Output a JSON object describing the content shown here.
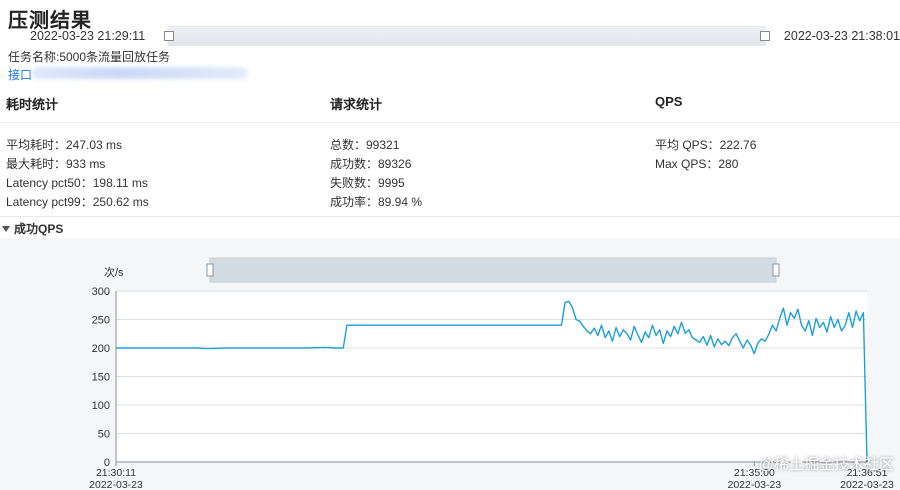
{
  "header": {
    "title": "压测结果",
    "start_time": "2022-03-23 21:29:11",
    "end_time": "2022-03-23 21:38:01",
    "task_label": "任务名称:5000条流量回放任务",
    "api_label": "接口"
  },
  "stats": {
    "latency": {
      "heading": "耗时统计",
      "lines": [
        "平均耗时：247.03 ms",
        "最大耗时：933 ms",
        "Latency pct50：198.11 ms",
        "Latency pct99：250.62 ms"
      ]
    },
    "requests": {
      "heading": "请求统计",
      "lines": [
        "总数：99321",
        "成功数：89326",
        "失败数：9995",
        "成功率：89.94 %"
      ]
    },
    "qps": {
      "heading": "QPS",
      "lines": [
        "平均 QPS：222.76",
        "Max QPS：280"
      ]
    }
  },
  "chart_section": {
    "label": "成功QPS"
  },
  "watermark": "@稀土掘金技术社区",
  "chart_data": {
    "type": "line",
    "ylabel": "次/s",
    "ylim": [
      0,
      300
    ],
    "yticks": [
      0,
      50,
      100,
      150,
      200,
      250,
      300
    ],
    "xrange": [
      0,
      340
    ],
    "xticks": [
      {
        "x": 0,
        "time": "21:30:11",
        "date": "2022-03-23"
      },
      {
        "x": 289,
        "time": "21:35:00",
        "date": "2022-03-23"
      },
      {
        "x": 340,
        "time": "21:36:51",
        "date": "2022-03-23"
      }
    ],
    "color": "#1aa0d8",
    "series": [
      {
        "points": [
          [
            0,
            200
          ],
          [
            15,
            200
          ],
          [
            30,
            200
          ],
          [
            45,
            200
          ],
          [
            50,
            199
          ],
          [
            60,
            200
          ],
          [
            75,
            200
          ],
          [
            90,
            200
          ],
          [
            105,
            200
          ],
          [
            115,
            201
          ],
          [
            120,
            200
          ],
          [
            125,
            200
          ],
          [
            127,
            240
          ],
          [
            140,
            240
          ],
          [
            155,
            240
          ],
          [
            170,
            240
          ],
          [
            185,
            240
          ],
          [
            200,
            240
          ],
          [
            215,
            240
          ],
          [
            230,
            240
          ],
          [
            245,
            240
          ],
          [
            247,
            280
          ],
          [
            249,
            282
          ],
          [
            251,
            271
          ],
          [
            253,
            250
          ],
          [
            255,
            247
          ],
          [
            257,
            238
          ],
          [
            259,
            230
          ],
          [
            261,
            225
          ],
          [
            263,
            235
          ],
          [
            265,
            222
          ],
          [
            267,
            240
          ],
          [
            269,
            218
          ],
          [
            271,
            230
          ],
          [
            273,
            212
          ],
          [
            275,
            236
          ],
          [
            277,
            220
          ],
          [
            279,
            232
          ],
          [
            281,
            225
          ],
          [
            283,
            214
          ],
          [
            285,
            238
          ],
          [
            287,
            223
          ],
          [
            289,
            210
          ],
          [
            291,
            228
          ],
          [
            293,
            218
          ],
          [
            295,
            240
          ],
          [
            297,
            222
          ],
          [
            299,
            232
          ],
          [
            301,
            208
          ],
          [
            303,
            230
          ],
          [
            305,
            220
          ],
          [
            307,
            238
          ],
          [
            309,
            225
          ],
          [
            311,
            245
          ],
          [
            313,
            226
          ],
          [
            315,
            232
          ],
          [
            317,
            218
          ],
          [
            319,
            214
          ],
          [
            321,
            210
          ],
          [
            323,
            220
          ],
          [
            325,
            205
          ],
          [
            327,
            222
          ],
          [
            329,
            202
          ],
          [
            331,
            216
          ],
          [
            333,
            206
          ],
          [
            335,
            212
          ],
          [
            337,
            204
          ],
          [
            339,
            218
          ],
          [
            341,
            225
          ],
          [
            343,
            212
          ],
          [
            345,
            200
          ],
          [
            347,
            214
          ],
          [
            349,
            205
          ],
          [
            351,
            190
          ],
          [
            353,
            209
          ],
          [
            355,
            216
          ],
          [
            357,
            212
          ],
          [
            359,
            224
          ],
          [
            361,
            240
          ],
          [
            363,
            230
          ],
          [
            365,
            252
          ],
          [
            367,
            270
          ],
          [
            369,
            240
          ],
          [
            371,
            262
          ],
          [
            373,
            252
          ],
          [
            375,
            268
          ],
          [
            377,
            240
          ],
          [
            379,
            230
          ],
          [
            381,
            248
          ],
          [
            383,
            222
          ],
          [
            385,
            252
          ],
          [
            387,
            236
          ],
          [
            389,
            245
          ],
          [
            391,
            228
          ],
          [
            393,
            255
          ],
          [
            395,
            236
          ],
          [
            397,
            250
          ],
          [
            399,
            230
          ],
          [
            401,
            240
          ],
          [
            403,
            262
          ],
          [
            405,
            236
          ],
          [
            407,
            265
          ],
          [
            409,
            248
          ],
          [
            411,
            262
          ],
          [
            413,
            0
          ]
        ]
      }
    ]
  }
}
